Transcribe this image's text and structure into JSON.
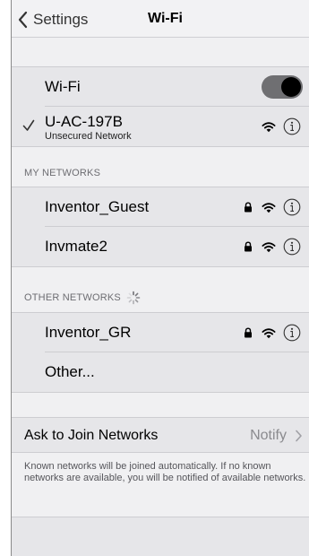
{
  "nav": {
    "back_label": "Settings",
    "title": "Wi-Fi"
  },
  "wifi_toggle": {
    "label": "Wi-Fi",
    "on": true
  },
  "connected": {
    "name": "U-AC-197B",
    "subtitle": "Unsecured Network",
    "icons": [
      "checkmark-icon",
      "wifi-icon",
      "info-icon"
    ]
  },
  "my_networks": {
    "header": "MY NETWORKS",
    "items": [
      {
        "name": "Inventor_Guest",
        "locked": true
      },
      {
        "name": "Invmate2",
        "locked": true
      }
    ]
  },
  "other_networks": {
    "header": "OTHER NETWORKS",
    "items": [
      {
        "name": "Inventor_GR",
        "locked": true
      }
    ],
    "other_label": "Other..."
  },
  "ask_to_join": {
    "label": "Ask to Join Networks",
    "value": "Notify",
    "footnote": "Known networks will be joined automatically. If no known networks are available, you will be notified of available networks."
  },
  "colors": {
    "toggle_track": "#6f6f72",
    "row_bg": "#e6e6e9",
    "page_bg": "#f0f0f2"
  }
}
